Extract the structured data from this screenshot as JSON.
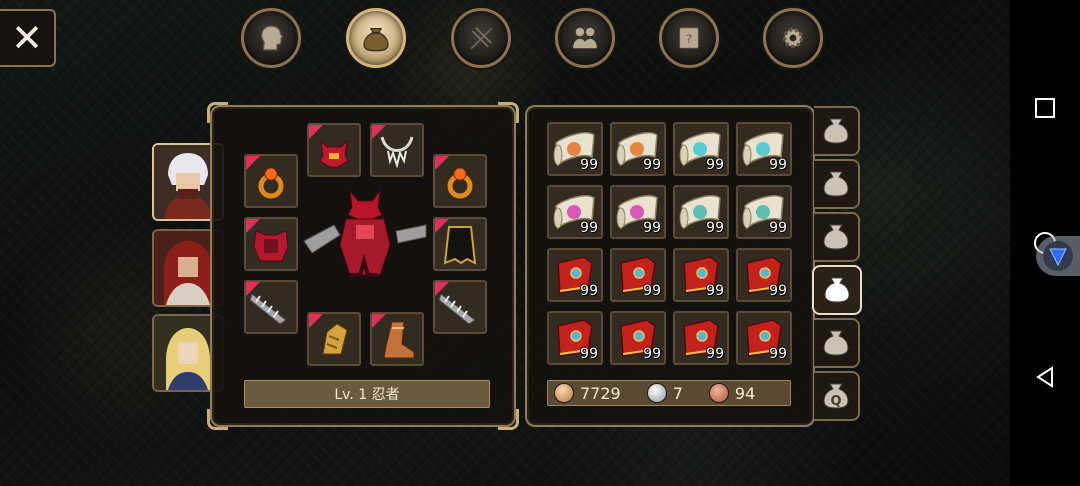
{
  "colors": {
    "panel_border": "#8f7b58",
    "equip_flag": "#e0305a",
    "level_bar": "#6c5a3e"
  },
  "top_menu": [
    {
      "name": "character",
      "icon": "head-icon",
      "active": false
    },
    {
      "name": "inventory",
      "icon": "bag-icon",
      "active": true
    },
    {
      "name": "skills",
      "icon": "blade-icon",
      "active": false
    },
    {
      "name": "party",
      "icon": "party-icon",
      "active": false
    },
    {
      "name": "quests",
      "icon": "scroll-icon",
      "active": false
    },
    {
      "name": "settings",
      "icon": "gear-icon",
      "active": false
    }
  ],
  "close_button": {
    "icon": "close-icon",
    "glyph": "✕"
  },
  "characters": [
    {
      "portrait": "white-haired-warrior",
      "selected": true
    },
    {
      "portrait": "red-haired-mage",
      "selected": false
    },
    {
      "portrait": "blonde-elf",
      "selected": false
    }
  ],
  "equipment": {
    "level_label": "Lv. 1 忍者",
    "slots": [
      {
        "item": "helmet-icon",
        "equipped": true
      },
      {
        "item": "necklace-icon",
        "equipped": true
      },
      {
        "item": "ring-icon",
        "equipped": true
      },
      {
        "item": "ring-icon",
        "equipped": true
      },
      {
        "item": "armor-icon",
        "equipped": true
      },
      {
        "item": "cape-icon",
        "equipped": true
      },
      {
        "item": "claw-weapon-icon",
        "equipped": true
      },
      {
        "item": "claw-weapon-icon",
        "equipped": true
      },
      {
        "item": "gauntlet-icon",
        "equipped": true
      },
      {
        "item": "boots-icon",
        "equipped": true
      }
    ]
  },
  "inventory": {
    "items": [
      {
        "icon": "scroll-orange-icon",
        "qty": "99"
      },
      {
        "icon": "scroll-orange-icon",
        "qty": "99"
      },
      {
        "icon": "scroll-cyan-icon",
        "qty": "99"
      },
      {
        "icon": "scroll-cyan-icon",
        "qty": "99"
      },
      {
        "icon": "scroll-pink-icon",
        "qty": "99"
      },
      {
        "icon": "scroll-pink-icon",
        "qty": "99"
      },
      {
        "icon": "scroll-teal-icon",
        "qty": "99"
      },
      {
        "icon": "scroll-teal-icon",
        "qty": "99"
      },
      {
        "icon": "red-book-icon",
        "qty": "99"
      },
      {
        "icon": "red-book-icon",
        "qty": "99"
      },
      {
        "icon": "red-book-icon",
        "qty": "99"
      },
      {
        "icon": "red-book-icon",
        "qty": "99"
      },
      {
        "icon": "red-book-icon",
        "qty": "99"
      },
      {
        "icon": "red-book-icon",
        "qty": "99"
      },
      {
        "icon": "red-book-icon",
        "qty": "99"
      },
      {
        "icon": "red-book-icon",
        "qty": "99"
      }
    ],
    "currency": {
      "gold": "7729",
      "silver": "7",
      "bronze": "94"
    }
  },
  "bag_tabs": [
    {
      "icon": "bag-icon",
      "active": false
    },
    {
      "icon": "bag-icon",
      "active": false
    },
    {
      "icon": "bag-icon",
      "active": false
    },
    {
      "icon": "bag-icon",
      "active": true
    },
    {
      "icon": "bag-icon",
      "active": false
    },
    {
      "icon": "quest-bag-icon",
      "letter": "Q",
      "active": false
    }
  ],
  "system_nav": [
    {
      "name": "recents",
      "icon": "square-icon"
    },
    {
      "name": "home",
      "icon": "circle-icon"
    },
    {
      "name": "back",
      "icon": "triangle-back-icon"
    }
  ]
}
